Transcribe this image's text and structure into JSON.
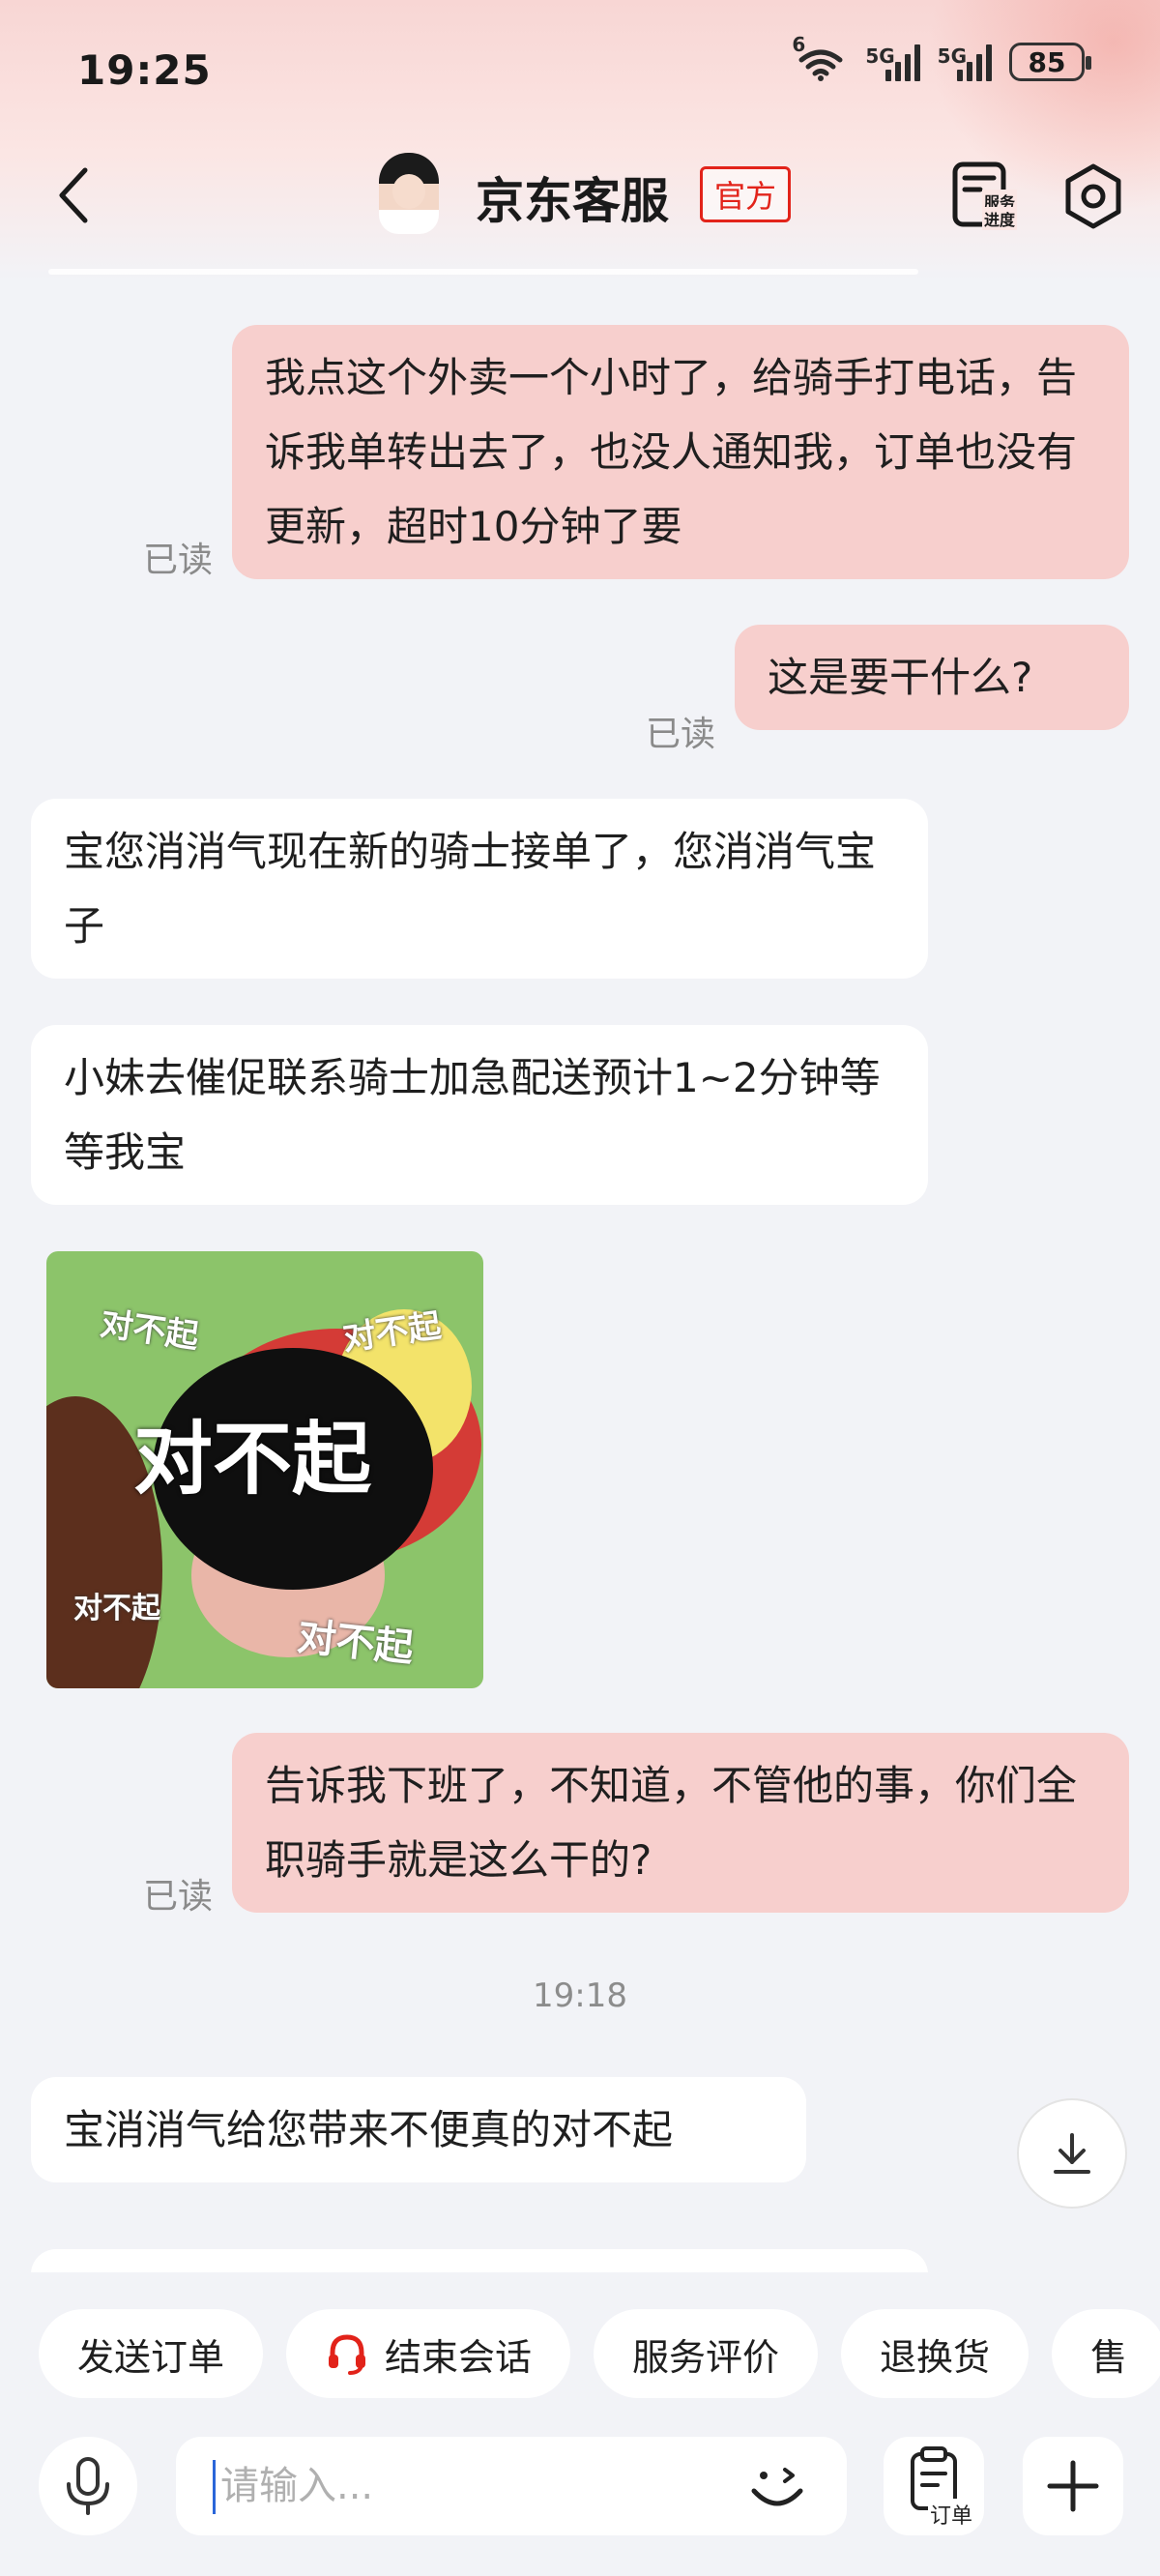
{
  "status_bar": {
    "time": "19:25",
    "network_1": "6",
    "network_2": "5G",
    "network_3": "5G",
    "battery": "85"
  },
  "header": {
    "title": "京东客服",
    "badge": "官方",
    "service_progress_label_1": "服务",
    "service_progress_label_2": "进度"
  },
  "messages": [
    {
      "sender": "me",
      "text": "我点这个外卖一个小时了，给骑手打电话，告诉我单转出去了，也没人通知我，订单也没有更新，超时10分钟了要",
      "read": "已读"
    },
    {
      "sender": "me",
      "text": "这是要干什么?",
      "read": "已读"
    },
    {
      "sender": "service",
      "text": "宝您消消气现在新的骑士接单了，您消消气宝子"
    },
    {
      "sender": "service",
      "text": "小妹去催促联系骑士加急配送预计1~2分钟等等我宝"
    },
    {
      "sender": "service",
      "type": "sticker",
      "texts": [
        "对不起",
        "对不起",
        "对不起",
        "对不起",
        "对不起"
      ]
    },
    {
      "sender": "me",
      "text": "告诉我下班了，不知道，不管他的事，你们全职骑手就是这么干的?",
      "read": "已读"
    },
    {
      "type": "timestamp",
      "text": "19:18"
    },
    {
      "sender": "service",
      "text": "宝消消气给您带来不便真的对不起"
    }
  ],
  "quick_actions": [
    "发送订单",
    "结束会话",
    "服务评价",
    "退换货",
    "售"
  ],
  "input": {
    "placeholder": "请输入...",
    "value": "",
    "order_label": "订单"
  },
  "colors": {
    "accent": "#e2231a",
    "my_bubble": "#f7cfcd",
    "their_bubble": "#ffffff",
    "background": "#f2f3f7"
  }
}
